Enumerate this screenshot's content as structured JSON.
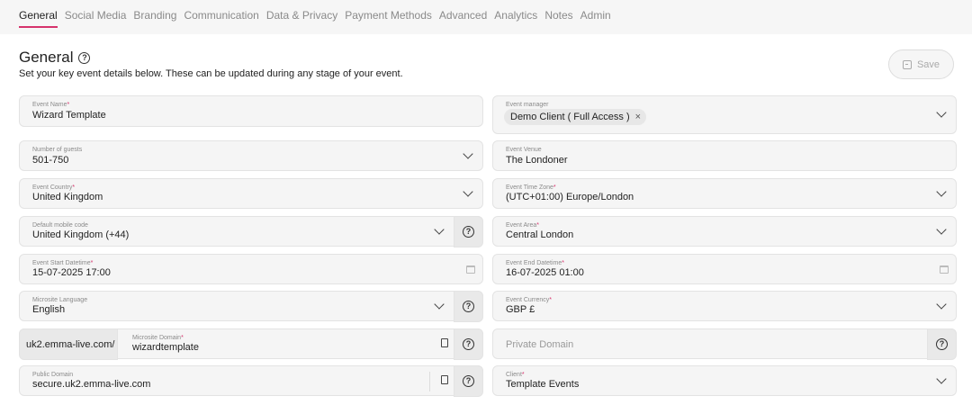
{
  "tabs": [
    {
      "label": "General",
      "active": true
    },
    {
      "label": "Social Media"
    },
    {
      "label": "Branding"
    },
    {
      "label": "Communication"
    },
    {
      "label": "Data & Privacy"
    },
    {
      "label": "Payment Methods"
    },
    {
      "label": "Advanced"
    },
    {
      "label": "Analytics"
    },
    {
      "label": "Notes"
    },
    {
      "label": "Admin"
    }
  ],
  "header": {
    "title": "General",
    "subtitle": "Set your key event details below. These can be updated during any stage of your event.",
    "save_label": "Save"
  },
  "fields": {
    "event_name": {
      "label": "Event Name",
      "value": "Wizard Template"
    },
    "event_manager": {
      "label": "Event manager",
      "chip": "Demo Client ( Full Access )"
    },
    "guests": {
      "label": "Number of guests",
      "value": "501-750"
    },
    "venue": {
      "label": "Event Venue",
      "value": "The Londoner"
    },
    "country": {
      "label": "Event Country",
      "value": "United Kingdom"
    },
    "timezone": {
      "label": "Event Time Zone",
      "value": "(UTC+01:00) Europe/London"
    },
    "mobile_code": {
      "label": "Default mobile code",
      "value": "United Kingdom (+44)"
    },
    "area": {
      "label": "Event Area",
      "value": "Central London"
    },
    "start": {
      "label": "Event Start Datetime",
      "value": "15-07-2025 17:00"
    },
    "end": {
      "label": "Event End Datetime",
      "value": "16-07-2025 01:00"
    },
    "language": {
      "label": "Microsite Language",
      "value": "English"
    },
    "currency": {
      "label": "Event Currency",
      "value": "GBP £"
    },
    "microsite_domain": {
      "prefix": "uk2.emma-live.com/",
      "label": "Microsite Domain",
      "value": "wizardtemplate"
    },
    "private_domain": {
      "placeholder": "Private Domain"
    },
    "public_domain": {
      "label": "Public Domain",
      "value": "secure.uk2.emma-live.com"
    },
    "client": {
      "label": "Client",
      "value": "Template Events"
    }
  },
  "icons": {
    "help": "?",
    "remove": "×"
  },
  "colors": {
    "accent": "#d6336c",
    "field_bg": "#f5f5f5"
  }
}
